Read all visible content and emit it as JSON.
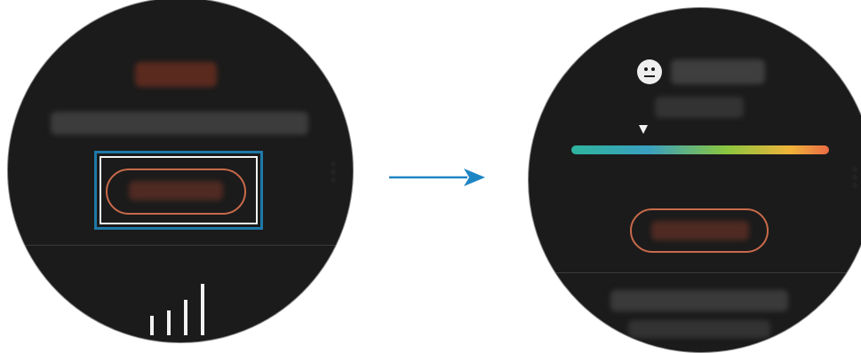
{
  "left_screen": {
    "blurred_title": "",
    "blurred_description": "",
    "blurred_button_label": "",
    "bar_icon": "signal-bars-icon"
  },
  "right_screen": {
    "blurred_title": "",
    "blurred_subtitle": "",
    "blurred_button_label": "",
    "face_icon": "neutral-face-icon",
    "gauge_level_percent": 28,
    "gauge_colors": [
      "#2fb49e",
      "#3aa0c0",
      "#8ac63f",
      "#f0b43a",
      "#ea6b45"
    ]
  },
  "highlight_color": "#1f79a8",
  "arrow_color": "#1f86c4",
  "accent_color": "#c86a4a",
  "menu_icon": "more-options-icon"
}
